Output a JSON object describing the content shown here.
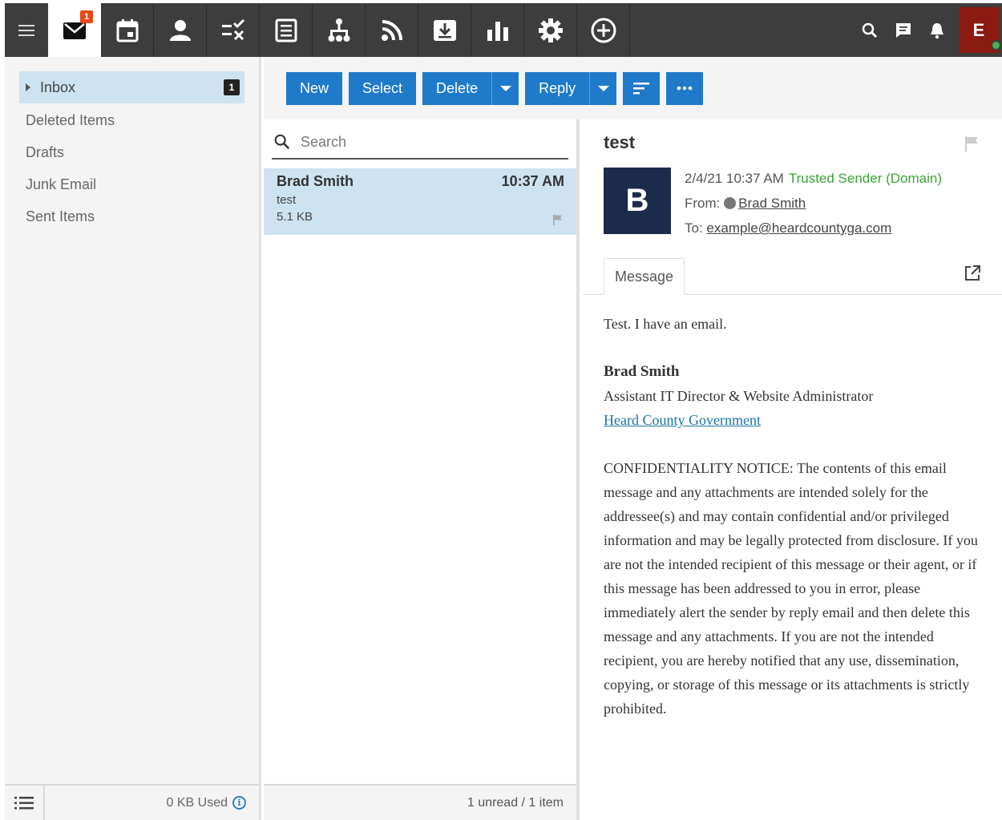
{
  "topbar": {
    "mail_badge": "1",
    "user_initial": "E",
    "apps": [
      "mail-icon",
      "calendar-icon",
      "contacts-icon",
      "tasks-icon",
      "notes-icon",
      "sitemap-icon",
      "feed-icon",
      "download-box-icon",
      "chart-icon",
      "gear-icon",
      "add-circle-icon"
    ],
    "right_icons": [
      "search-icon",
      "chat-icon",
      "bell-icon"
    ]
  },
  "sidebar": {
    "folders": [
      {
        "label": "Inbox",
        "count": "1"
      },
      {
        "label": "Deleted Items"
      },
      {
        "label": "Drafts"
      },
      {
        "label": "Junk Email"
      },
      {
        "label": "Sent Items"
      }
    ],
    "storage": "0 KB Used"
  },
  "toolbar": {
    "new": "New",
    "select": "Select",
    "delete": "Delete",
    "reply": "Reply"
  },
  "list": {
    "search_placeholder": "Search",
    "items": [
      {
        "sender": "Brad Smith",
        "time": "10:37 AM",
        "subject": "test",
        "size": "5.1 KB"
      }
    ],
    "status": "1 unread / 1 item"
  },
  "reader": {
    "subject": "test",
    "avatar_initial": "B",
    "date": "2/4/21 10:37 AM",
    "trust": "Trusted Sender (Domain)",
    "from_label": "From:",
    "from": "Brad Smith",
    "to_label": "To:",
    "to": "example@heardcountyga.com",
    "tab": "Message",
    "body_line": "Test. I have an email.",
    "sig_name": "Brad Smith",
    "sig_title": "Assistant IT Director & Website Administrator",
    "sig_link": "Heard County Government",
    "notice": "CONFIDENTIALITY NOTICE: The contents of this email message and any attachments are intended solely for the addressee(s) and may contain confidential and/or privileged information and may be legally protected from disclosure. If you are not the intended recipient of this message or their agent, or if this message has been addressed to you in error, please immediately alert the sender by reply email and then delete this message and any attachments. If you are not the intended recipient, you are hereby notified that any use, dissemination, copying, or storage of this message or its attachments is strictly prohibited."
  },
  "colors": {
    "topbar": "#3d3d3d",
    "accent": "#1f7ac9",
    "selection": "#cde3f1",
    "trusted": "#3aa537",
    "avatar_user": "#8b1a10",
    "avatar_sender": "#1c2b4a"
  }
}
